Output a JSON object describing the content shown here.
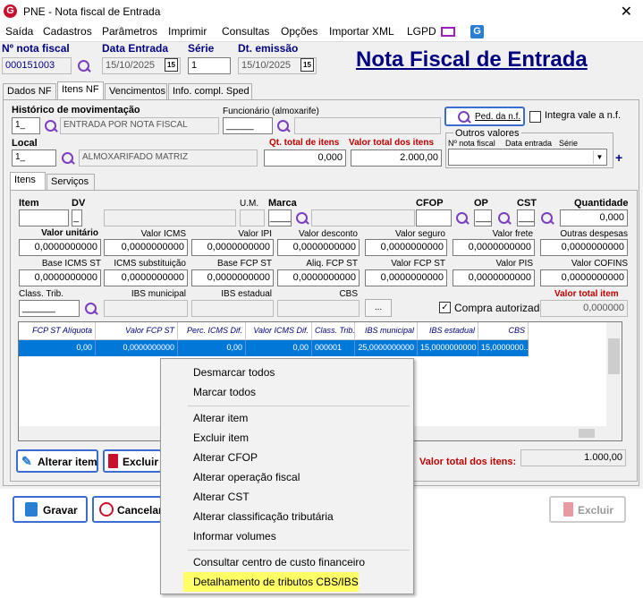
{
  "window": {
    "title": "PNE - Nota fiscal de Entrada",
    "close": "✕"
  },
  "menu": [
    "Saída",
    "Cadastros",
    "Parâmetros",
    "Imprimir",
    "Consultas",
    "Opções",
    "Importar XML",
    "LGPD"
  ],
  "header": {
    "nota_label": "Nº nota fiscal",
    "nota_value": "000151003",
    "data_entrada_label": "Data Entrada",
    "data_entrada_value": "15/10/2025",
    "serie_label": "Série",
    "serie_value": "1",
    "dt_emissao_label": "Dt. emissão",
    "dt_emissao_value": "15/10/2025",
    "big_title": "Nota Fiscal de Entrada",
    "cal_icon": "15"
  },
  "tabs": [
    "Dados NF",
    "Itens NF",
    "Vencimentos",
    "Info. compl. Sped"
  ],
  "itens_nf": {
    "historico_label": "Histórico de movimentação",
    "historico_code": "1_",
    "historico_desc": "ENTRADA POR NOTA FISCAL",
    "funcionario_label": "Funcionário (almoxarife)",
    "funcionario_code": "_____",
    "ped_button": "Ped. da n.f.",
    "integra_label": "Integra vale a n.f.",
    "local_label": "Local",
    "local_code": "1_",
    "local_desc": "ALMOXARIFADO MATRIZ",
    "qt_total_label": "Qt. total de itens",
    "qt_total_value": "0,000",
    "valor_total_label": "Valor total dos itens",
    "valor_total_value": "2.000,00",
    "outros_valores_label": "Outros valores",
    "outros_nf": "Nº nota fiscal",
    "outros_data": "Data entrada",
    "outros_serie": "Série",
    "plus": "+"
  },
  "sub_tabs": [
    "Itens",
    "Serviços"
  ],
  "item_fields": {
    "item": "Item",
    "dv": "DV",
    "dv_value": "_",
    "um": "U.M.",
    "marca": "Marca",
    "marca_value": "____",
    "cfop": "CFOP",
    "op": "OP",
    "op_value": "___",
    "cst": "CST",
    "cst_value": "___",
    "quantidade": "Quantidade",
    "quantidade_value": "0,000",
    "row2_labels": [
      "Valor unitário",
      "Valor ICMS",
      "Valor IPI",
      "Valor desconto",
      "Valor seguro",
      "Valor frete",
      "Outras despesas"
    ],
    "row2_values": [
      "0,0000000000",
      "0,0000000000",
      "0,0000000000",
      "0,0000000000",
      "0,0000000000",
      "0,0000000000",
      "0,0000000000"
    ],
    "row3_labels": [
      "Base ICMS ST",
      "ICMS substituição",
      "Base FCP ST",
      "Aliq. FCP ST",
      "Valor FCP ST",
      "Valor PIS",
      "Valor COFINS"
    ],
    "row3_values": [
      "0,0000000000",
      "0,0000000000",
      "0,0000000000",
      "0,0000000000",
      "0,0000000000",
      "0,0000000000",
      "0,0000000000"
    ],
    "class_trib": "Class. Trib.",
    "class_trib_value": "______",
    "ibs_municipal": "IBS municipal",
    "ibs_estadual": "IBS estadual",
    "cbs": "CBS",
    "ellipsis": "...",
    "compra_autorizada": "Compra autorizada",
    "check": "✓",
    "valor_total_item": "Valor total item",
    "valor_total_item_value": "0,000000"
  },
  "grid": {
    "headers": [
      "FCP ST Alíquota",
      "Valor FCP ST",
      "Perc. ICMS Dif.",
      "Valor ICMS Dif.",
      "Class. Trib.",
      "IBS municipal",
      "IBS estadual",
      "CBS"
    ],
    "row": [
      "0,00",
      "0,0000000000",
      "0,00",
      "0,00",
      "000001",
      "25,0000000000",
      "15,0000000000",
      "15,0000000..."
    ]
  },
  "buttons": {
    "alterar_item": "Alterar item",
    "excluir": "Excluir",
    "gravar": "Gravar",
    "cancelar": "Cancelar",
    "excluir_bottom": "Excluir"
  },
  "footer_total": {
    "label": "Valor total dos itens:",
    "value": "1.000,00"
  },
  "context_menu": [
    "Desmarcar todos",
    "Marcar todos",
    "Alterar item",
    "Excluir item",
    "Alterar CFOP",
    "Alterar operação fiscal",
    "Alterar CST",
    "Alterar classificação tributária",
    "Informar volumes",
    "Consultar centro de custo financeiro",
    "Detalhamento de tributos CBS/IBS"
  ],
  "colors": {
    "navy": "#000080",
    "red": "#c00000",
    "highlight": "#ffff66",
    "selection": "#0078d7"
  }
}
